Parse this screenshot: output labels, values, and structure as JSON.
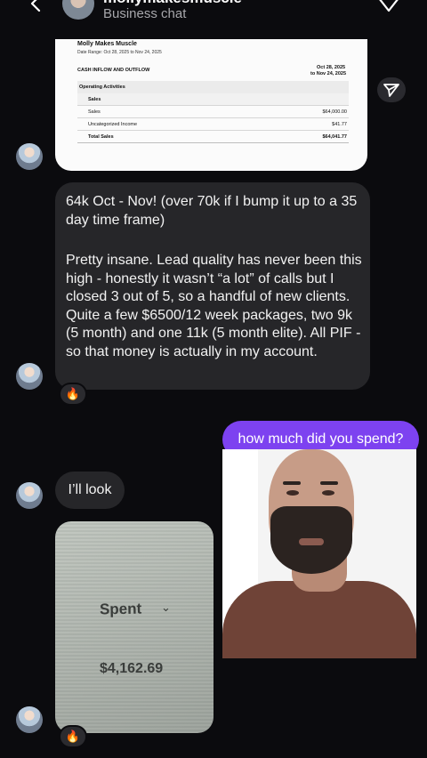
{
  "header": {
    "contact_name": "mollymakesmuscle",
    "subtitle": "Business chat"
  },
  "report": {
    "title": "Molly Makes Muscle",
    "date_range": "Date Range: Oct 28, 2025 to Nov 24, 2025",
    "section": "CASH INFLOW AND OUTFLOW",
    "period_line1": "Oct 28, 2025",
    "period_line2": "to Nov 24, 2025",
    "rows": [
      {
        "label": "Operating Activities",
        "amount": ""
      },
      {
        "label": "Sales",
        "amount": ""
      },
      {
        "label": "Sales",
        "amount": "$64,000.00"
      },
      {
        "label": "Uncategorized Income",
        "amount": "$41.77"
      },
      {
        "label": "Total Sales",
        "amount": "$64,041.77"
      }
    ]
  },
  "messages": {
    "incoming_long_p1": "64k Oct - Nov! (over 70k if I bump it up to a 35 day time frame)",
    "incoming_long_p2": "Pretty insane. Lead quality has never been this high - honestly it wasn’t “a lot” of calls but I closed 3 out of 5, so a handful of new clients. Quite a few $6500/12 week packages, two 9k (5 month) and one 11k (5 month elite). All PIF - so that money is actually in my account.",
    "outgoing": "how much did you spend?",
    "incoming_short": "I’ll look",
    "reaction_emoji": "🔥"
  },
  "photo": {
    "label": "Spent",
    "amount": "$4,162.69"
  },
  "colors": {
    "background": "#0b0b0e",
    "incoming_bubble": "#262629",
    "outgoing_bubble": "#7d42f0"
  },
  "icons": [
    "back-icon",
    "info-icon",
    "send-icon",
    "chevron-down-icon",
    "fire-emoji"
  ]
}
